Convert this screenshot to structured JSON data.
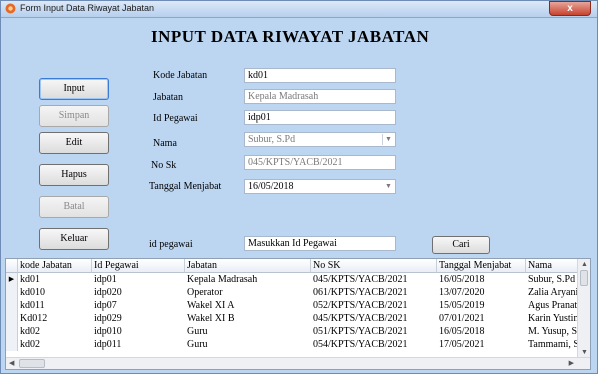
{
  "window": {
    "title": "Form Input Data Riwayat Jabatan",
    "close_label": "x"
  },
  "heading": "INPUT DATA RIWAYAT JABATAN",
  "buttons": {
    "input": "Input",
    "simpan": "Simpan",
    "edit": "Edit",
    "hapus": "Hapus",
    "batal": "Batal",
    "keluar": "Keluar"
  },
  "form": {
    "kode_jabatan_label": "Kode Jabatan",
    "kode_jabatan_value": "kd01",
    "jabatan_label": "Jabatan",
    "jabatan_value": "Kepala Madrasah",
    "id_pegawai_label": "Id Pegawai",
    "id_pegawai_value": "idp01",
    "nama_label": "Nama",
    "nama_value": "Subur, S.Pd",
    "no_sk_label": "No Sk",
    "no_sk_value": "045/KPTS/YACB/2021",
    "tanggal_label": "Tanggal Menjabat",
    "tanggal_value": "16/05/2018"
  },
  "search": {
    "label": "id pegawai",
    "value": "Masukkan Id Pegawai",
    "button": "Cari"
  },
  "grid": {
    "columns": [
      "kode Jabatan",
      "Id Pegawai",
      "Jabatan",
      "No SK",
      "Tanggal Menjabat",
      "Nama"
    ],
    "rows": [
      [
        "kd01",
        "idp01",
        "Kepala Madrasah",
        "045/KPTS/YACB/2021",
        "16/05/2018",
        "Subur, S.Pd"
      ],
      [
        "kd010",
        "idp020",
        "Operator",
        "061/KPTS/YACB/2021",
        "13/07/2020",
        "Zalia Aryani,"
      ],
      [
        "kd011",
        "idp07",
        "Wakel XI A",
        "052/KPTS/YACB/2021",
        "15/05/2019",
        "Agus Pranatr"
      ],
      [
        "Kd012",
        "idp029",
        "Wakel XI B",
        "045/KPTS/YACB/2021",
        "07/01/2021",
        "Karin Yustin"
      ],
      [
        "kd02",
        "idp010",
        "Guru",
        "051/KPTS/YACB/2021",
        "16/05/2018",
        "M. Yusup, S"
      ],
      [
        "kd02",
        "idp011",
        "Guru",
        "054/KPTS/YACB/2021",
        "17/05/2021",
        "Tammami, S"
      ]
    ],
    "current_row_marker": "▶"
  },
  "icons": {
    "app": "app-icon",
    "combo": "chevron-down-icon"
  },
  "colors": {
    "form_bg": "#bcd6f2",
    "close_red": "#c7432f"
  }
}
